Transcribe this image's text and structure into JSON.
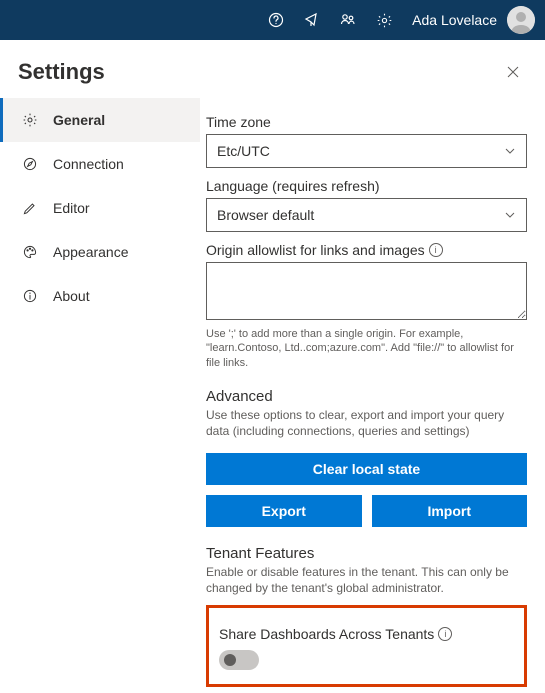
{
  "topbar": {
    "username": "Ada Lovelace"
  },
  "page": {
    "title": "Settings"
  },
  "sidebar": {
    "items": [
      {
        "label": "General"
      },
      {
        "label": "Connection"
      },
      {
        "label": "Editor"
      },
      {
        "label": "Appearance"
      },
      {
        "label": "About"
      }
    ]
  },
  "general": {
    "timezone_label": "Time zone",
    "timezone_value": "Etc/UTC",
    "language_label": "Language (requires refresh)",
    "language_value": "Browser default",
    "origin_label": "Origin allowlist for links and images",
    "origin_value": "",
    "origin_hint": "Use ';' to add more than a single origin. For example, \"learn.Contoso, Ltd..com;azure.com\". Add \"file://\" to allowlist for file links.",
    "advanced_title": "Advanced",
    "advanced_desc": "Use these options to clear, export and import your query data (including connections, queries and settings)",
    "clear_btn": "Clear local state",
    "export_btn": "Export",
    "import_btn": "Import",
    "tenant_title": "Tenant Features",
    "tenant_desc": "Enable or disable features in the tenant. This can only be changed by the tenant's global administrator.",
    "share_label": "Share Dashboards Across Tenants"
  }
}
